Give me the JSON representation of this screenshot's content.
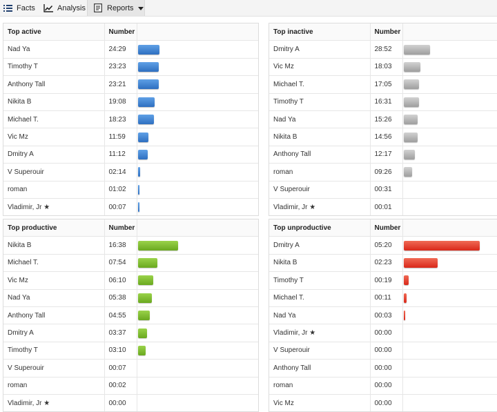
{
  "toolbar": {
    "facts_label": "Facts",
    "analysis_label": "Analysis",
    "reports_label": "Reports"
  },
  "panels": [
    {
      "title": "Top active",
      "number_header": "Number",
      "color": "blue",
      "max_minutes": 1469,
      "rows": [
        {
          "name": "Nad Ya",
          "value": "24:29",
          "minutes": 1469
        },
        {
          "name": "Timothy T",
          "value": "23:23",
          "minutes": 1403
        },
        {
          "name": "Anthony Tall",
          "value": "23:21",
          "minutes": 1401
        },
        {
          "name": "Nikita B",
          "value": "19:08",
          "minutes": 1148
        },
        {
          "name": "Michael T.",
          "value": "18:23",
          "minutes": 1103
        },
        {
          "name": "Vic Mz",
          "value": "11:59",
          "minutes": 719
        },
        {
          "name": "Dmitry A",
          "value": "11:12",
          "minutes": 672
        },
        {
          "name": "V Superouir",
          "value": "02:14",
          "minutes": 134
        },
        {
          "name": "roman",
          "value": "01:02",
          "minutes": 62
        },
        {
          "name": "Vladimir, Jr ★",
          "value": "00:07",
          "minutes": 7
        }
      ]
    },
    {
      "title": "Top inactive",
      "number_header": "Number",
      "color": "gray",
      "max_minutes": 1732,
      "rows": [
        {
          "name": "Dmitry A",
          "value": "28:52",
          "minutes": 1732
        },
        {
          "name": "Vic Mz",
          "value": "18:03",
          "minutes": 1083
        },
        {
          "name": "Michael T.",
          "value": "17:05",
          "minutes": 1025
        },
        {
          "name": "Timothy T",
          "value": "16:31",
          "minutes": 991
        },
        {
          "name": "Nad Ya",
          "value": "15:26",
          "minutes": 926
        },
        {
          "name": "Nikita B",
          "value": "14:56",
          "minutes": 896
        },
        {
          "name": "Anthony Tall",
          "value": "12:17",
          "minutes": 737
        },
        {
          "name": "roman",
          "value": "09:26",
          "minutes": 566
        },
        {
          "name": "V Superouir",
          "value": "00:31",
          "minutes": 0
        },
        {
          "name": "Vladimir, Jr ★",
          "value": "00:01",
          "minutes": 0
        }
      ]
    },
    {
      "title": "Top productive",
      "number_header": "Number",
      "color": "green",
      "max_minutes": 998,
      "rows": [
        {
          "name": "Nikita B",
          "value": "16:38",
          "minutes": 998
        },
        {
          "name": "Michael T.",
          "value": "07:54",
          "minutes": 474
        },
        {
          "name": "Vic Mz",
          "value": "06:10",
          "minutes": 370
        },
        {
          "name": "Nad Ya",
          "value": "05:38",
          "minutes": 338
        },
        {
          "name": "Anthony Tall",
          "value": "04:55",
          "minutes": 295
        },
        {
          "name": "Dmitry A",
          "value": "03:37",
          "minutes": 217
        },
        {
          "name": "Timothy T",
          "value": "03:10",
          "minutes": 190
        },
        {
          "name": "V Superouir",
          "value": "00:07",
          "minutes": 0
        },
        {
          "name": "roman",
          "value": "00:02",
          "minutes": 0
        },
        {
          "name": "Vladimir, Jr ★",
          "value": "00:00",
          "minutes": 0
        }
      ]
    },
    {
      "title": "Top unproductive",
      "number_header": "Number",
      "color": "red",
      "max_minutes": 320,
      "rows": [
        {
          "name": "Dmitry A",
          "value": "05:20",
          "minutes": 320
        },
        {
          "name": "Nikita B",
          "value": "02:23",
          "minutes": 143
        },
        {
          "name": "Timothy T",
          "value": "00:19",
          "minutes": 19
        },
        {
          "name": "Michael T.",
          "value": "00:11",
          "minutes": 11
        },
        {
          "name": "Nad Ya",
          "value": "00:03",
          "minutes": 3
        },
        {
          "name": "Vladimir, Jr ★",
          "value": "00:00",
          "minutes": 0
        },
        {
          "name": "V Superouir",
          "value": "00:00",
          "minutes": 0
        },
        {
          "name": "Anthony Tall",
          "value": "00:00",
          "minutes": 0
        },
        {
          "name": "roman",
          "value": "00:00",
          "minutes": 0
        },
        {
          "name": "Vic Mz",
          "value": "00:00",
          "minutes": 0
        }
      ]
    }
  ]
}
